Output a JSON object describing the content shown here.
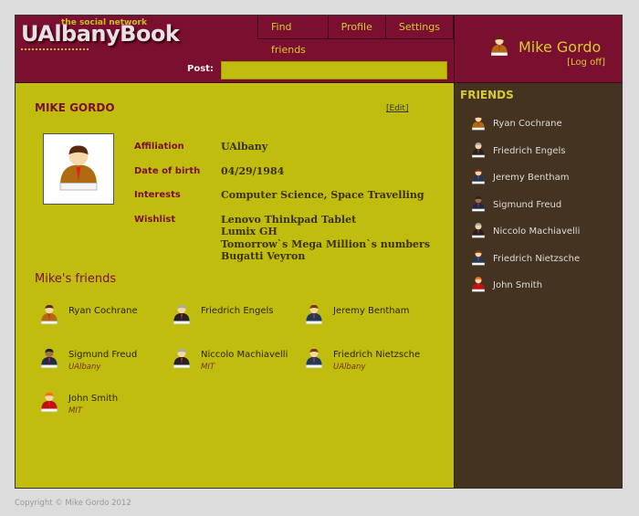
{
  "logo": {
    "text": "UAlbanyBook",
    "tagline": "the social network"
  },
  "nav": [
    {
      "label": "Find friends"
    },
    {
      "label": "Profile"
    },
    {
      "label": "Settings"
    }
  ],
  "post": {
    "label": "Post:",
    "value": ""
  },
  "user": {
    "name": "Mike Gordo",
    "logoff": "[Log off]"
  },
  "profile": {
    "title": "MIKE GORDO",
    "edit": "[Edit]",
    "fields": [
      {
        "label": "Affiliation",
        "value": "UAlbany"
      },
      {
        "label": "Date of birth",
        "value": "04/29/1984"
      },
      {
        "label": "Interests",
        "value": "Computer Science, Space Travelling"
      },
      {
        "label": "Wishlist",
        "value": "Lenovo Thinkpad Tablet\nLumix GH\nTomorrow`s Mega Million`s numbers\nBugatti Veyron"
      }
    ]
  },
  "friends_title": "Mike's friends",
  "friends": [
    {
      "name": "Ryan Cochrane",
      "affiliation": "",
      "hair": "#5a2a10",
      "shirt": "#b06a10",
      "skin": "#f5d9a8"
    },
    {
      "name": "Friedrich Engels",
      "affiliation": "",
      "hair": "#aaaaaa",
      "shirt": "#222222",
      "skin": "#f5d9a8"
    },
    {
      "name": "Jeremy Bentham",
      "affiliation": "",
      "hair": "#8a3010",
      "shirt": "#1e3a5a",
      "skin": "#f5d9a8"
    },
    {
      "name": "Sigmund Freud",
      "affiliation": "UAlbany",
      "hair": "#222222",
      "shirt": "#1e2a4a",
      "skin": "#a07040"
    },
    {
      "name": "Niccolo Machiavelli",
      "affiliation": "MIT",
      "hair": "#aaaaaa",
      "shirt": "#222222",
      "skin": "#f5d9a8"
    },
    {
      "name": "Friedrich Nietzsche",
      "affiliation": "UAlbany",
      "hair": "#8a3010",
      "shirt": "#1e3a5a",
      "skin": "#f5d9a8"
    },
    {
      "name": "John Smith",
      "affiliation": "MIT",
      "hair": "#ff6a10",
      "shirt": "#c01010",
      "skin": "#f5d9a8"
    }
  ],
  "sidebar": {
    "title": "FRIENDS"
  },
  "footer": "Copyright © Mike Gordo 2012",
  "colors": {
    "header": "#7a0f30",
    "main": "#c0bd0e",
    "sidebar": "#433320",
    "accent": "#d6cc30"
  }
}
